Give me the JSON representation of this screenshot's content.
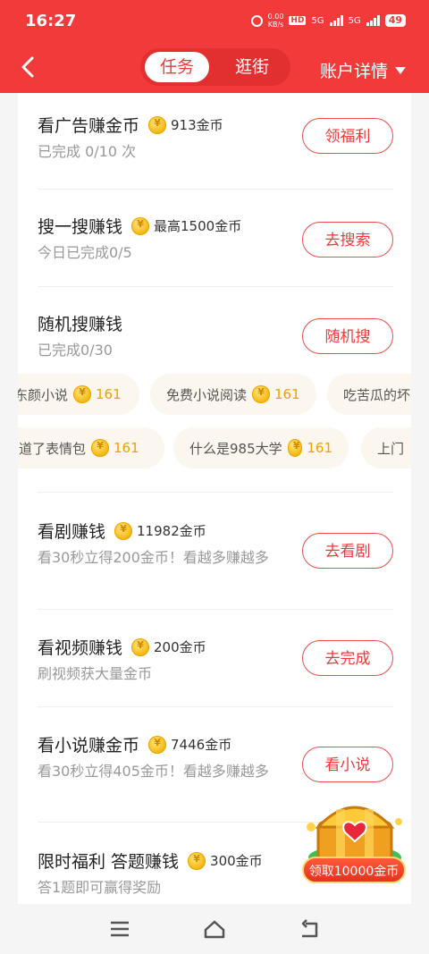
{
  "status": {
    "time": "16:27",
    "speed_top": "0.00",
    "speed_bottom": "KB/s",
    "hd": "HD",
    "net1": "5G",
    "net2": "5G",
    "battery": "49"
  },
  "nav": {
    "tabs": [
      "任务",
      "逛街"
    ],
    "account_label": "账户详情"
  },
  "tasks": [
    {
      "title": "看广告赚金币",
      "reward": "913金币",
      "desc": "已完成 0/10 次",
      "button": "领福利"
    },
    {
      "title": "搜一搜赚钱",
      "reward": "最高1500金币",
      "desc": "今日已完成0/5",
      "button": "去搜索"
    },
    {
      "title": "随机搜赚钱",
      "reward": "",
      "desc": "已完成0/30",
      "button": "随机搜"
    },
    {
      "title": "看剧赚钱",
      "reward": "11982金币",
      "desc": "看30秒立得200金币！看越多赚越多",
      "button": "去看剧"
    },
    {
      "title": "看视频赚钱",
      "reward": "200金币",
      "desc": "刷视频获大量金币",
      "button": "去完成"
    },
    {
      "title": "看小说赚金币",
      "reward": "7446金币",
      "desc": "看30秒立得405金币！看越多赚越多",
      "button": "看小说"
    },
    {
      "title": "限时福利 答题赚钱",
      "reward": "300金币",
      "desc": "答1题即可赢得奖励",
      "button": ""
    }
  ],
  "search_chips": [
    [
      {
        "text": "东颜小说",
        "value": "161"
      },
      {
        "text": "免费小说阅读",
        "value": "161"
      },
      {
        "text": "吃苦瓜的坏",
        "value": ""
      }
    ],
    [
      {
        "text": "知道了表情包",
        "value": "161"
      },
      {
        "text": "什么是985大学",
        "value": "161"
      },
      {
        "text": "上门",
        "value": ""
      }
    ]
  ],
  "promo": {
    "label": "领取10000金币"
  },
  "colors": {
    "brand": "#f23a3a",
    "coin": "#f5b50a"
  }
}
